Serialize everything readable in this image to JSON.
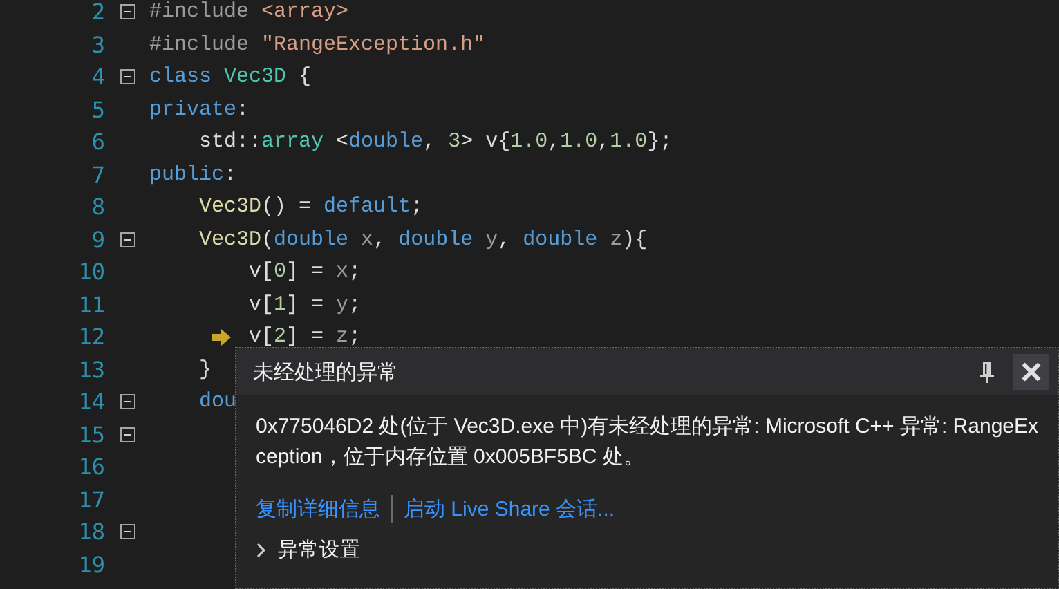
{
  "editor": {
    "lines": [
      {
        "number": "2",
        "fold": true,
        "current": false,
        "tokens": [
          {
            "kind": "preproc",
            "text": "#include "
          },
          {
            "kind": "string",
            "text": "<array>"
          }
        ]
      },
      {
        "number": "3",
        "fold": false,
        "current": false,
        "tokens": [
          {
            "kind": "preproc",
            "text": "#include "
          },
          {
            "kind": "string",
            "text": "\"RangeException.h\""
          }
        ]
      },
      {
        "number": "4",
        "fold": true,
        "current": false,
        "tokens": [
          {
            "kind": "keyword",
            "text": "class "
          },
          {
            "kind": "type",
            "text": "Vec3D"
          },
          {
            "kind": "plain",
            "text": " {"
          }
        ]
      },
      {
        "number": "5",
        "fold": false,
        "current": false,
        "tokens": [
          {
            "kind": "keyword",
            "text": "private"
          },
          {
            "kind": "plain",
            "text": ":"
          }
        ]
      },
      {
        "number": "6",
        "fold": false,
        "current": false,
        "tokens": [
          {
            "kind": "plain",
            "text": "    std::"
          },
          {
            "kind": "type",
            "text": "array"
          },
          {
            "kind": "plain",
            "text": " <"
          },
          {
            "kind": "keyword",
            "text": "double"
          },
          {
            "kind": "plain",
            "text": ", "
          },
          {
            "kind": "number",
            "text": "3"
          },
          {
            "kind": "plain",
            "text": "> v{"
          },
          {
            "kind": "number",
            "text": "1.0"
          },
          {
            "kind": "plain",
            "text": ","
          },
          {
            "kind": "number",
            "text": "1.0"
          },
          {
            "kind": "plain",
            "text": ","
          },
          {
            "kind": "number",
            "text": "1.0"
          },
          {
            "kind": "plain",
            "text": "};"
          }
        ]
      },
      {
        "number": "7",
        "fold": false,
        "current": false,
        "tokens": [
          {
            "kind": "keyword",
            "text": "public"
          },
          {
            "kind": "plain",
            "text": ":"
          }
        ]
      },
      {
        "number": "8",
        "fold": false,
        "current": false,
        "tokens": [
          {
            "kind": "func",
            "text": "    Vec3D"
          },
          {
            "kind": "plain",
            "text": "() = "
          },
          {
            "kind": "keyword",
            "text": "default"
          },
          {
            "kind": "plain",
            "text": ";"
          }
        ]
      },
      {
        "number": "9",
        "fold": true,
        "current": false,
        "tokens": [
          {
            "kind": "func",
            "text": "    Vec3D"
          },
          {
            "kind": "plain",
            "text": "("
          },
          {
            "kind": "keyword",
            "text": "double"
          },
          {
            "kind": "param",
            "text": " x"
          },
          {
            "kind": "plain",
            "text": ", "
          },
          {
            "kind": "keyword",
            "text": "double"
          },
          {
            "kind": "param",
            "text": " y"
          },
          {
            "kind": "plain",
            "text": ", "
          },
          {
            "kind": "keyword",
            "text": "double"
          },
          {
            "kind": "param",
            "text": " z"
          },
          {
            "kind": "plain",
            "text": "){"
          }
        ]
      },
      {
        "number": "10",
        "fold": false,
        "current": false,
        "tokens": [
          {
            "kind": "plain",
            "text": "        v["
          },
          {
            "kind": "number",
            "text": "0"
          },
          {
            "kind": "plain",
            "text": "] = "
          },
          {
            "kind": "param",
            "text": "x"
          },
          {
            "kind": "plain",
            "text": ";"
          }
        ]
      },
      {
        "number": "11",
        "fold": false,
        "current": false,
        "tokens": [
          {
            "kind": "plain",
            "text": "        v["
          },
          {
            "kind": "number",
            "text": "1"
          },
          {
            "kind": "plain",
            "text": "] = "
          },
          {
            "kind": "param",
            "text": "y"
          },
          {
            "kind": "plain",
            "text": ";"
          }
        ]
      },
      {
        "number": "12",
        "fold": false,
        "current": true,
        "tokens": [
          {
            "kind": "plain",
            "text": "        v["
          },
          {
            "kind": "number",
            "text": "2"
          },
          {
            "kind": "plain",
            "text": "] = "
          },
          {
            "kind": "param",
            "text": "z"
          },
          {
            "kind": "plain",
            "text": ";"
          }
        ]
      },
      {
        "number": "13",
        "fold": false,
        "current": false,
        "tokens": [
          {
            "kind": "plain",
            "text": "    }"
          }
        ]
      },
      {
        "number": "14",
        "fold": true,
        "current": false,
        "tokens": [
          {
            "kind": "keyword",
            "text": "    dou"
          }
        ]
      },
      {
        "number": "15",
        "fold": true,
        "current": false
      },
      {
        "number": "16",
        "fold": false,
        "current": false
      },
      {
        "number": "17",
        "fold": false,
        "current": false
      },
      {
        "number": "18",
        "fold": true,
        "current": false
      },
      {
        "number": "19",
        "fold": false,
        "current": false
      }
    ]
  },
  "exception_popup": {
    "title": "未经处理的异常",
    "message": "0x775046D2 处(位于 Vec3D.exe 中)有未经处理的异常: Microsoft C++ 异常: RangeException，位于内存位置 0x005BF5BC 处。",
    "links": [
      "复制详细信息",
      "启动 Live Share 会话..."
    ],
    "settings": {
      "label": "异常设置",
      "expanded": false
    }
  }
}
